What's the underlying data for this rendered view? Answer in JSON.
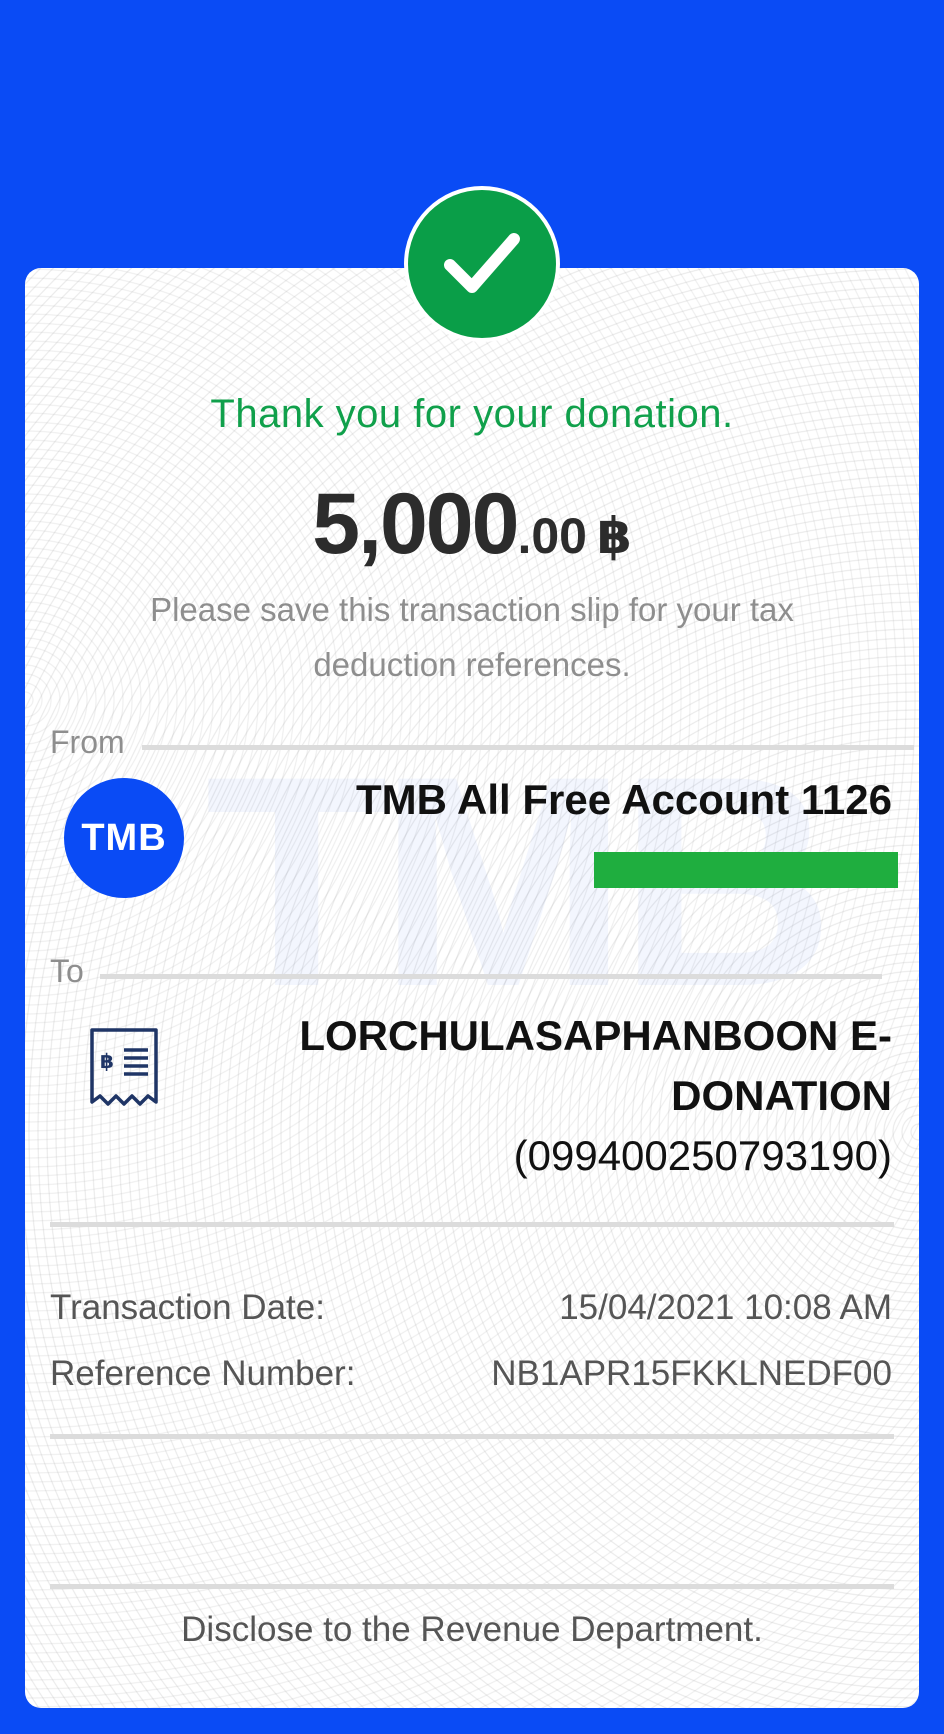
{
  "header": {
    "status_icon": "check-icon",
    "thanks": "Thank you for your donation."
  },
  "amount": {
    "whole": "5,000",
    "decimals": ".00",
    "currency": "฿"
  },
  "note": "Please save this transaction slip for your tax deduction references.",
  "watermark": "TMB",
  "from": {
    "label": "From",
    "bank_logo_text": "TMB",
    "account": "TMB All Free Account 1126"
  },
  "to": {
    "label": "To",
    "icon": "receipt-icon",
    "name": "LORCHULASAPHANBOON E-DONATION",
    "id": "(099400250793190)"
  },
  "details": {
    "date_label": "Transaction Date:",
    "date_value": "15/04/2021 10:08 AM",
    "ref_label": "Reference Number:",
    "ref_value": "NB1APR15FKKLNEDF00"
  },
  "footer": {
    "disclose": "Disclose to the Revenue Department."
  },
  "colors": {
    "background": "#0a4bf5",
    "success": "#10a04b",
    "text_dark": "#111111",
    "text_muted": "#8e8e8e",
    "redaction": "#1fae3f"
  }
}
